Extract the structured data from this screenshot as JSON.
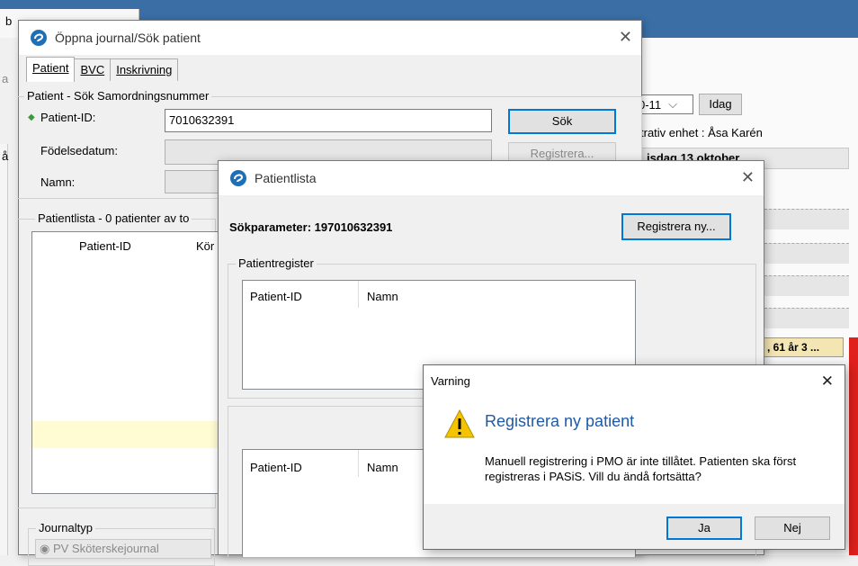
{
  "background": {
    "tab_fragment": "b",
    "side_fragment": "a",
    "col_fragment": "å",
    "date_value": "0-11",
    "date_chevron": "⌵",
    "idag_button": "Idag",
    "unit_text": "trativ enhet : Åsa Karén",
    "day_header": "isdag 13 oktober",
    "appointment": ", 61 år 3 ..."
  },
  "open_journal_window": {
    "title": "Öppna journal/Sök patient",
    "close_glyph": "✕",
    "tabs": [
      "Patient",
      "BVC",
      "Inskrivning"
    ],
    "search_group_title": "Patient - Sök Samordningsnummer",
    "patient_id_label": "Patient-ID:",
    "patient_id_value": "7010632391",
    "birthdate_label": "Födelsedatum:",
    "name_label": "Namn:",
    "search_button": "Sök",
    "register_button": "Registrera...",
    "patient_list_title": "Patientlista - 0 patienter av to",
    "list_columns": [
      "Patient-ID",
      "Kör"
    ],
    "journal_type_title": "Journaltyp",
    "journal_option": "PV Sköterskejournal"
  },
  "patient_list_window": {
    "title": "Patientlista",
    "close_glyph": "✕",
    "search_param": "Sökparameter: 197010632391",
    "register_new_button": "Registrera ny...",
    "register_group_title": "Patientregister",
    "columns_top": [
      "Patient-ID",
      "Namn"
    ],
    "columns_bottom": [
      "Patient-ID",
      "Namn"
    ]
  },
  "warning_dialog": {
    "title": "Varning",
    "close_glyph": "✕",
    "heading": "Registrera ny patient",
    "message": "Manuell registrering i PMO är inte tillåtet. Patienten ska först registreras i PASiS. Vill du ändå fortsätta?",
    "yes_button": "Ja",
    "no_button": "Nej"
  },
  "colors": {
    "titlebar": "#3a6ea5",
    "accent": "#0078d7",
    "heading_blue": "#1e5aa8",
    "warning_yellow": "#f5c400",
    "appointment_red": "#e0201c"
  }
}
